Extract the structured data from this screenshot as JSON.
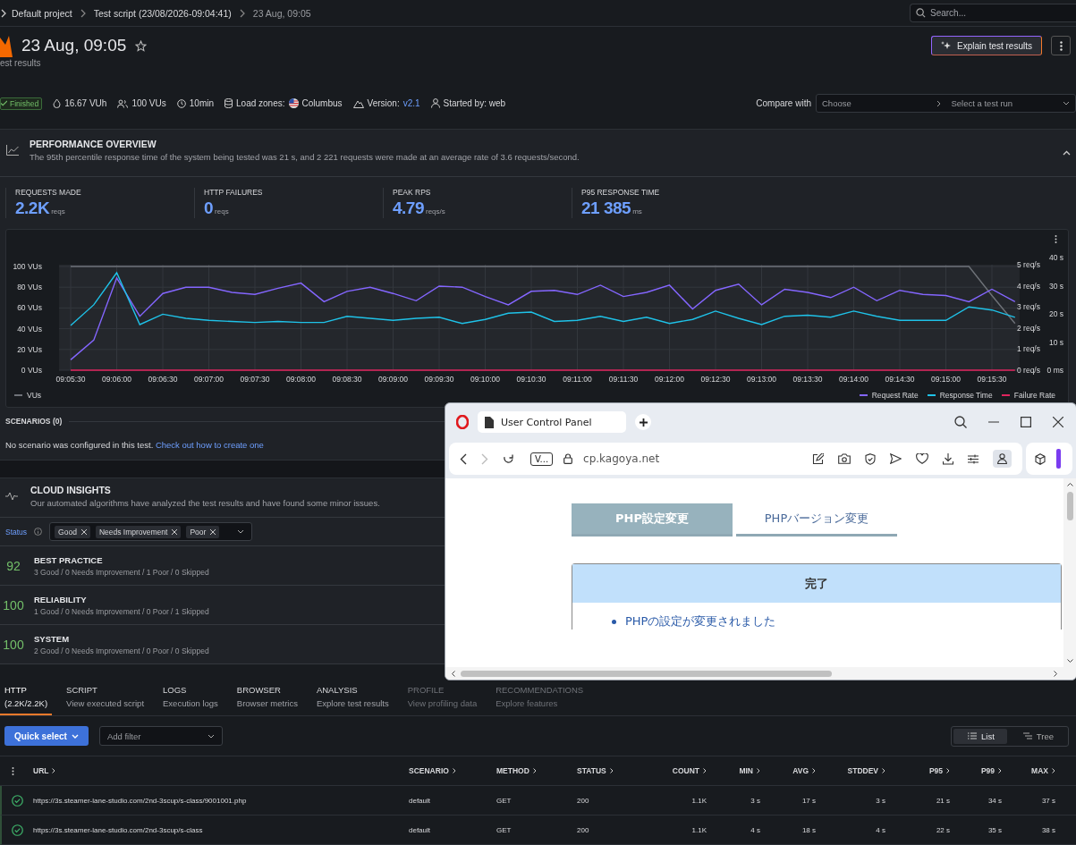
{
  "breadcrumb": [
    "Default project",
    "Test script (23/08/2026-09:04:41)",
    "23 Aug, 09:05"
  ],
  "search": {
    "placeholder": "Search..."
  },
  "header": {
    "title": "23 Aug, 09:05",
    "starred": false,
    "subtitle": "est results",
    "explain_button": "Explain test results"
  },
  "run_info": {
    "status": "Finished",
    "vuh": "16.67 VUh",
    "vus": "100 VUs",
    "duration": "10min",
    "load_zones_label": "Load zones:",
    "load_zone": "Columbus",
    "version_label": "Version:",
    "version": "v2.1",
    "started_by": "Started by: web"
  },
  "compare": {
    "label": "Compare with",
    "choose_placeholder": "Choose",
    "run_placeholder": "Select a test run"
  },
  "performance_overview": {
    "title": "PERFORMANCE OVERVIEW",
    "summary": "The 95th percentile response time of the system being tested was 21 s, and 2 221 requests were made at an average rate of 3.6 requests/second.",
    "expanded": true,
    "metrics": [
      {
        "label": "REQUESTS MADE",
        "value": "2.2K",
        "unit": "reqs"
      },
      {
        "label": "HTTP FAILURES",
        "value": "0",
        "unit": "reqs"
      },
      {
        "label": "PEAK RPS",
        "value": "4.79",
        "unit": "reqs/s"
      },
      {
        "label": "P95 RESPONSE TIME",
        "value": "21 385",
        "unit": "ms"
      }
    ]
  },
  "chart": {
    "rate_ticks": [
      "5 req/s",
      "4 req/s",
      "3 req/s",
      "2 req/s",
      "1 req/s",
      "0 req/s"
    ],
    "time_ticks": [
      "40 s",
      "30 s",
      "20 s",
      "10 s",
      "0 ms"
    ],
    "chart_data": {
      "type": "line",
      "grid": true,
      "categories": [
        "09:05:30",
        null,
        "09:06:00",
        null,
        "09:06:30",
        null,
        "09:07:00",
        null,
        "09:07:30",
        null,
        "09:08:00",
        null,
        "09:08:30",
        null,
        "09:09:00",
        null,
        "09:09:30",
        null,
        "09:10:00",
        null,
        "09:10:30",
        null,
        "09:11:00",
        null,
        "09:11:30",
        null,
        "09:12:00",
        null,
        "09:12:30",
        null,
        "09:13:00",
        null,
        "09:13:30",
        null,
        "09:14:00",
        null,
        "09:14:30",
        null,
        "09:15:00",
        null,
        "09:15:30",
        null
      ],
      "ylim": [
        0,
        100
      ],
      "yticks": [
        {
          "value": 0,
          "label": "0 VUs"
        },
        {
          "value": 20,
          "label": "20 VUs"
        },
        {
          "value": 40,
          "label": "40 VUs"
        },
        {
          "value": 60,
          "label": "60 VUs"
        },
        {
          "value": 80,
          "label": "80 VUs"
        },
        {
          "value": 100,
          "label": "100 VUs"
        }
      ],
      "series": [
        {
          "name": "VUs",
          "color": "#6e7278",
          "values": [
            100,
            100,
            100,
            100,
            100,
            100,
            100,
            100,
            100,
            100,
            100,
            100,
            100,
            100,
            100,
            100,
            100,
            100,
            100,
            100,
            100,
            100,
            100,
            100,
            100,
            100,
            100,
            100,
            100,
            100,
            100,
            100,
            100,
            100,
            100,
            100,
            100,
            100,
            100,
            100,
            72,
            45
          ]
        },
        {
          "name": "Request Rate",
          "color": "#8466ff",
          "values": [
            10,
            29,
            89,
            52,
            74,
            80,
            80,
            75,
            73,
            79,
            84,
            66,
            76,
            80,
            74,
            67,
            81,
            80,
            71,
            63,
            76,
            77,
            73,
            82,
            71,
            75,
            82,
            59,
            77,
            83,
            63,
            78,
            75,
            70,
            80,
            67,
            77,
            73,
            72,
            66,
            78,
            66
          ]
        },
        {
          "name": "Response Time",
          "color": "#1fc2e8",
          "values": [
            43,
            63,
            94,
            44,
            54,
            50,
            48,
            47,
            46,
            47,
            46,
            46,
            52,
            50,
            48,
            50,
            51,
            45,
            49,
            55,
            56,
            47,
            48,
            52,
            47,
            51,
            45,
            49,
            57,
            50,
            44,
            52,
            53,
            51,
            57,
            52,
            48,
            48,
            48,
            61,
            58,
            51
          ]
        },
        {
          "name": "Failure Rate",
          "color": "#e0245e",
          "values": [
            0,
            0,
            0,
            0,
            0,
            0,
            0,
            0,
            0,
            0,
            0,
            0,
            0,
            0,
            0,
            0,
            0,
            0,
            0,
            0,
            0,
            0,
            0,
            0,
            0,
            0,
            0,
            0,
            0,
            0,
            0,
            0,
            0,
            0,
            0,
            0,
            0,
            0,
            0,
            0,
            0,
            0
          ]
        }
      ]
    }
  },
  "scenarios": {
    "title": "SCENARIOS (0)",
    "message": "No scenario was configured in this test.",
    "link": "Check out how to create one"
  },
  "cloud_insights": {
    "title": "CLOUD INSIGHTS",
    "summary": "Our automated algorithms have analyzed the test results and have found some minor issues.",
    "filter_label": "Status",
    "filter_tags": [
      "Good",
      "Needs Improvement",
      "Poor"
    ],
    "categories": [
      {
        "score": "92",
        "name": "BEST PRACTICE",
        "detail": "3 Good / 0 Needs Improvement / 1 Poor / 0 Skipped"
      },
      {
        "score": "100",
        "name": "RELIABILITY",
        "detail": "1 Good / 0 Needs Improvement / 0 Poor / 1 Skipped"
      },
      {
        "score": "100",
        "name": "SYSTEM",
        "detail": "2 Good / 0 Needs Improvement / 0 Poor / 0 Skipped"
      }
    ]
  },
  "tabs": [
    {
      "label": "HTTP",
      "sublabel": "(2.2K/2.2K)",
      "selected": true
    },
    {
      "label": "SCRIPT",
      "sublabel": "View executed script",
      "selected": false
    },
    {
      "label": "LOGS",
      "sublabel": "Execution logs",
      "selected": false
    },
    {
      "label": "BROWSER",
      "sublabel": "Browser metrics",
      "selected": false
    },
    {
      "label": "ANALYSIS",
      "sublabel": "Explore test results",
      "selected": false
    },
    {
      "label": "PROFILE",
      "sublabel": "View profiling data",
      "selected": false,
      "disabled": true
    },
    {
      "label": "RECOMMENDATIONS",
      "sublabel": "Explore features",
      "selected": false,
      "disabled": true
    }
  ],
  "toolbar": {
    "quick_select": "Quick select",
    "filter_placeholder": "Add filter",
    "views": [
      {
        "label": "List",
        "kind": "list",
        "selected": true
      },
      {
        "label": "Tree",
        "kind": "tree",
        "selected": false
      }
    ]
  },
  "table": {
    "columns": [
      "URL",
      "SCENARIO",
      "METHOD",
      "STATUS",
      "COUNT",
      "MIN",
      "AVG",
      "STDDEV",
      "P95",
      "P99",
      "MAX"
    ],
    "rows": [
      {
        "ok": true,
        "cells": [
          "https://3s.steamer-lane-studio.com/2nd-3scup/s-class/9001001.php",
          "default",
          "GET",
          "200",
          "1.1K",
          "3 s",
          "17 s",
          "3 s",
          "21 s",
          "34 s",
          "37 s"
        ]
      },
      {
        "ok": true,
        "cells": [
          "https://3s.steamer-lane-studio.com/2nd-3scup/s-class",
          "default",
          "GET",
          "200",
          "1.1K",
          "4 s",
          "18 s",
          "4 s",
          "22 s",
          "35 s",
          "38 s"
        ]
      }
    ]
  },
  "browser": {
    "tab_title": "User Control Panel",
    "badge": "V...",
    "url": "cp.kagoya.net",
    "page_tabs": [
      {
        "label": "PHP設定変更",
        "selected": true
      },
      {
        "label": "PHPバージョン変更",
        "selected": false
      }
    ],
    "notice_title": "完了",
    "notice_items": [
      "PHPの設定が変更されました"
    ]
  }
}
